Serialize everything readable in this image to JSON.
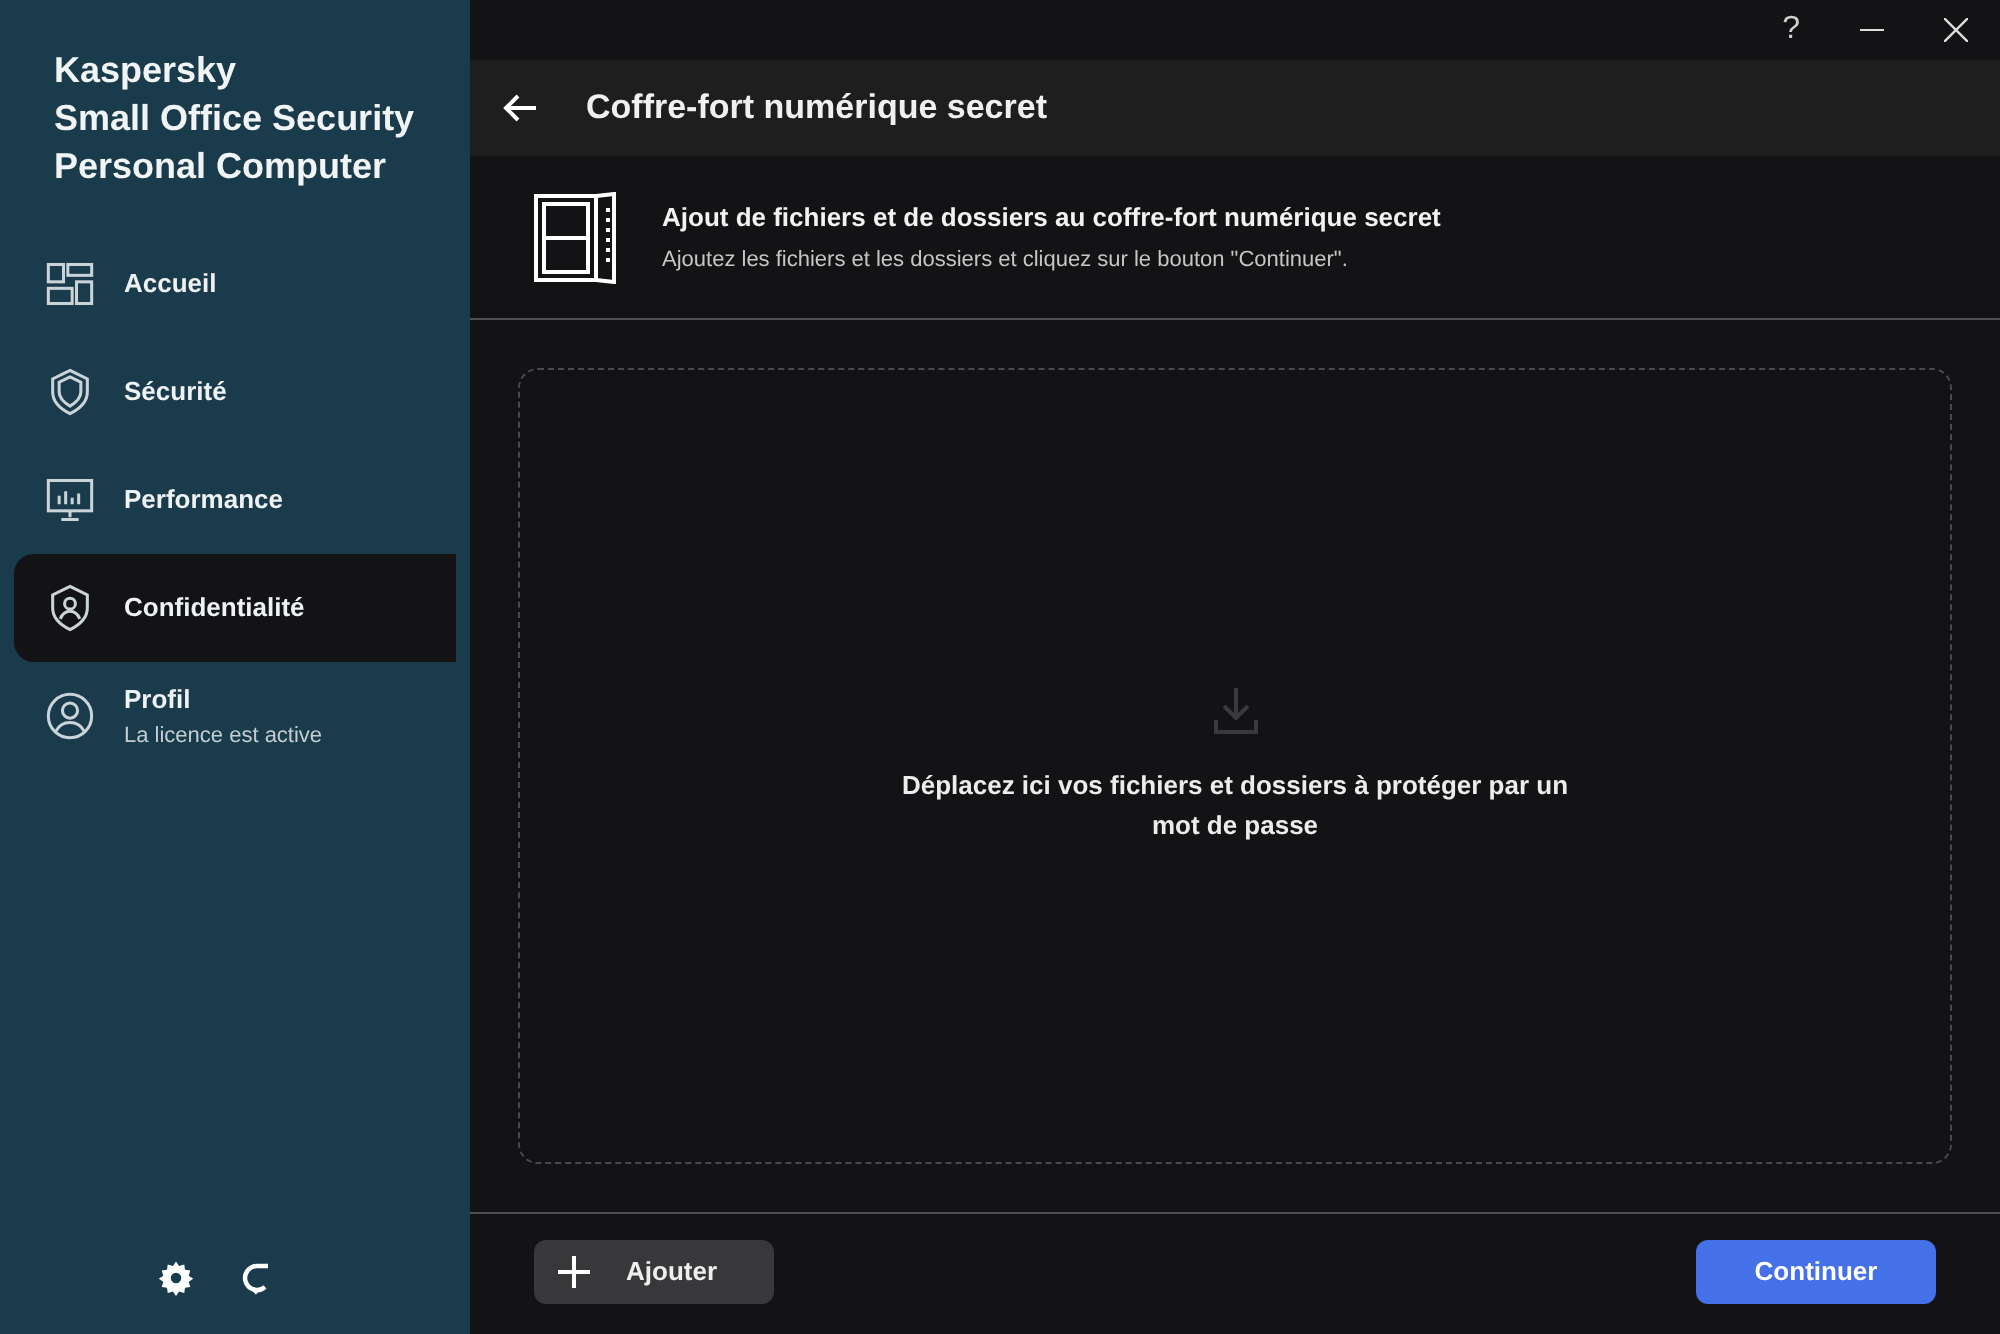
{
  "app_title": [
    "Kaspersky",
    "Small Office Security",
    "Personal Computer"
  ],
  "nav": [
    {
      "label": "Accueil",
      "selected": false
    },
    {
      "label": "Sécurité",
      "selected": false
    },
    {
      "label": "Performance",
      "selected": false
    },
    {
      "label": "Confidentialité",
      "selected": true
    },
    {
      "label": "Profil",
      "subtitle": "La licence est active",
      "selected": false
    }
  ],
  "window_controls": [
    "?"
  ],
  "page_title": "Coffre-fort numérique secret",
  "intro": {
    "title": "Ajout de fichiers et de dossiers au coffre-fort numérique secret",
    "description": "Ajoutez les fichiers et les dossiers et cliquez sur le bouton \"Continuer\"."
  },
  "drop_zone": {
    "text": "Déplacez ici vos fichiers et dossiers à protéger par un mot de passe"
  },
  "buttons": {
    "add": "Ajouter",
    "continue": "Continuer"
  }
}
